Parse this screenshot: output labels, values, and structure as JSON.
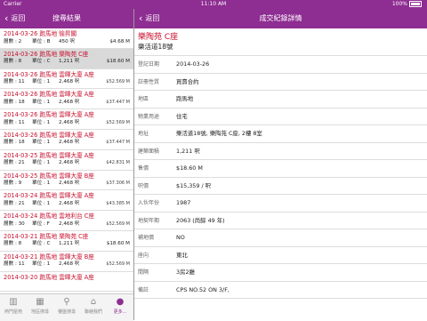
{
  "status": {
    "carrier": "Carrier",
    "time": "11:10 AM",
    "battery": "100%"
  },
  "left": {
    "back_label": "返回",
    "title": "搜尋結果",
    "rows": [
      {
        "title": "2014-03-26 跑馬地 愉昇閣",
        "floor": "層數 : 2",
        "unit": "單位 : B",
        "area": "450 呎",
        "price": "$4.68 M",
        "small": false,
        "selected": false
      },
      {
        "title": "2014-03-26 跑馬地 樂陶苑 C座",
        "floor": "層數 : 8",
        "unit": "單位 : C",
        "area": "1,211 呎",
        "price": "$18.60 M",
        "small": false,
        "selected": true
      },
      {
        "title": "2014-03-26 跑馬地 雲暉大廈 A座",
        "floor": "層數 : 11",
        "unit": "單位 : 1",
        "area": "2,468 呎",
        "price": "$52.569 M",
        "small": true,
        "selected": false
      },
      {
        "title": "2014-03-26 跑馬地 雲暉大廈 A座",
        "floor": "層數 : 18",
        "unit": "單位 : 1",
        "area": "2,468 呎",
        "price": "$37.447 M",
        "small": true,
        "selected": false
      },
      {
        "title": "2014-03-26 跑馬地 雲暉大廈 A座",
        "floor": "層數 : 11",
        "unit": "單位 : 1",
        "area": "2,468 呎",
        "price": "$52.569 M",
        "small": true,
        "selected": false
      },
      {
        "title": "2014-03-26 跑馬地 雲暉大廈 A座",
        "floor": "層數 : 18",
        "unit": "單位 : 1",
        "area": "2,468 呎",
        "price": "$37.447 M",
        "small": true,
        "selected": false
      },
      {
        "title": "2014-03-25 跑馬地 雲暉大廈 A座",
        "floor": "層數 : 21",
        "unit": "單位 : 1",
        "area": "2,468 呎",
        "price": "$42.831 M",
        "small": true,
        "selected": false
      },
      {
        "title": "2014-03-25 跑馬地 雲暉大廈 B座",
        "floor": "層數 : 9",
        "unit": "單位 : 1",
        "area": "2,468 呎",
        "price": "$37.306 M",
        "small": true,
        "selected": false
      },
      {
        "title": "2014-03-24 跑馬地 雲暉大廈 A座",
        "floor": "層數 : 21",
        "unit": "單位 : 1",
        "area": "2,468 呎",
        "price": "$43.385 M",
        "small": true,
        "selected": false
      },
      {
        "title": "2014-03-24 跑馬地 雲地利台 C座",
        "floor": "層數 : 30",
        "unit": "單位 : F",
        "area": "2,468 呎",
        "price": "$52.569 M",
        "small": true,
        "selected": false
      },
      {
        "title": "2014-03-21 跑馬地 樂陶苑 C座",
        "floor": "層數 : 8",
        "unit": "單位 : C",
        "area": "1,211 呎",
        "price": "$18.60 M",
        "small": false,
        "selected": false
      },
      {
        "title": "2014-03-21 跑馬地 雲暉大廈 B座",
        "floor": "層數 : 11",
        "unit": "單位 : 1",
        "area": "2,468 呎",
        "price": "$52.569 M",
        "small": true,
        "selected": false
      },
      {
        "title": "2014-03-20 跑馬地 雲暉大廈 A座",
        "floor": "",
        "unit": "",
        "area": "",
        "price": "",
        "small": true,
        "selected": false
      }
    ],
    "tabs": [
      {
        "label": "熱門屋苑",
        "icon": "building-icon",
        "glyph": "▥"
      },
      {
        "label": "地區搜尋",
        "icon": "map-icon",
        "glyph": "▦"
      },
      {
        "label": "樓盤搜尋",
        "icon": "search-icon",
        "glyph": "⚲"
      },
      {
        "label": "聯絡我們",
        "icon": "home-icon",
        "glyph": "⌂"
      },
      {
        "label": "更多...",
        "icon": "more-icon",
        "glyph": "●"
      }
    ]
  },
  "right": {
    "back_label": "返回",
    "title": "成交紀錄詳情",
    "estate": "樂陶苑 C座",
    "street": "樂活道18號",
    "details": [
      {
        "label": "登記日期",
        "value": "2014-03-26"
      },
      {
        "label": "註冊性質",
        "value": "買賣合約"
      },
      {
        "label": "地區",
        "value": "跑馬地"
      },
      {
        "label": "物業用途",
        "value": "住宅"
      },
      {
        "label": "地址",
        "value": "樂活道18號, 樂陶苑 C座, 2樓 8室"
      },
      {
        "label": "建築面積",
        "value": "1,211 呎"
      },
      {
        "label": "售價",
        "value": "$18.60 M"
      },
      {
        "label": "呎價",
        "value": "$15,359 / 呎"
      },
      {
        "label": "入伙年份",
        "value": "1987"
      },
      {
        "label": "地契年期",
        "value": "2063 (尚餘 49 年)"
      },
      {
        "label": "補地價",
        "value": "NO"
      },
      {
        "label": "座向",
        "value": "東北"
      },
      {
        "label": "間隔",
        "value": "3房2廳"
      },
      {
        "label": "備註",
        "value": "CPS NO.52 ON 3/F,"
      }
    ]
  },
  "colors": {
    "accent": "#8e2d92",
    "red_text": "#c8102e",
    "selected_row": "#d9d9d9"
  }
}
